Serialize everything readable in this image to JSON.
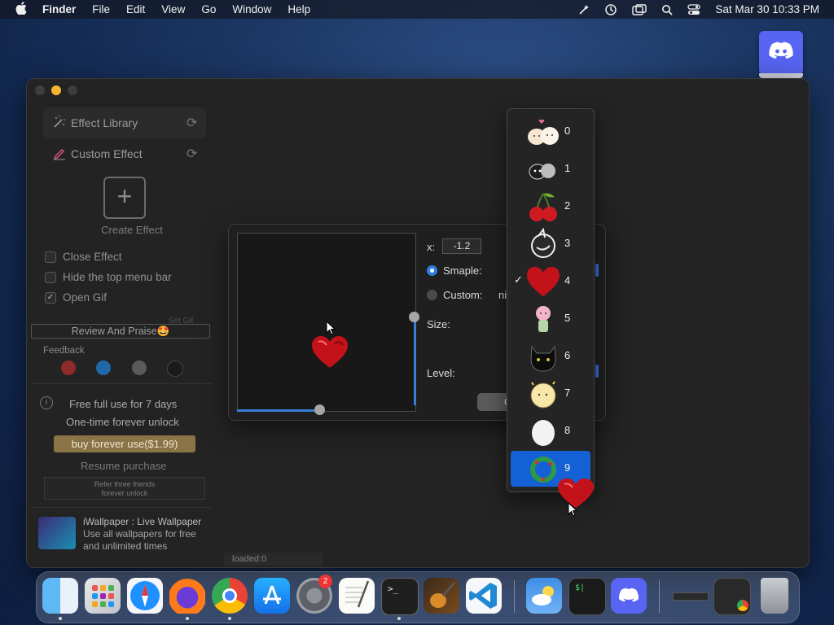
{
  "menubar": {
    "app_name": "Finder",
    "items": [
      "File",
      "Edit",
      "View",
      "Go",
      "Window",
      "Help"
    ],
    "clock": "Sat Mar 30  10:33 PM"
  },
  "sidebar": {
    "items": [
      {
        "label": "Effect Library",
        "icon": "sparkle-wand-icon"
      },
      {
        "label": "Custom Effect",
        "icon": "pen-icon"
      }
    ],
    "create_label": "Create Effect",
    "checkboxes": [
      {
        "label": "Close Effect",
        "checked": false
      },
      {
        "label": "Hide the top menu bar",
        "checked": false
      },
      {
        "label": "Open Gif",
        "checked": true
      }
    ],
    "set_gif_label": "Set Gif",
    "review_label": "Review And Praise🤩",
    "feedback_label": "Feedback",
    "trial_line1": "Free full use for 7 days",
    "trial_line2": "One-time forever unlock",
    "buy_label": "buy forever use($1.99)",
    "resume_label": "Resume purchase",
    "refer_line1": "Refer three friends",
    "refer_line2": "forever unlock",
    "ad_title": "iWallpaper : Live Wallpaper",
    "ad_line1": "Use all wallpapers for free",
    "ad_line2": "and unlimited times"
  },
  "status": {
    "loaded": "loaded:0"
  },
  "editor": {
    "x_label": "x:",
    "x_value": "-1.2",
    "sample_label": "Smaple:",
    "custom_label": "Custom:",
    "custom_value_partial": "ni",
    "size_label": "Size:",
    "level_label": "Level:",
    "button_partial": "C"
  },
  "dropdown": {
    "items": [
      "0",
      "1",
      "2",
      "3",
      "4",
      "5",
      "6",
      "7",
      "8",
      "9"
    ],
    "checked_index": 4,
    "highlighted_index": 9
  },
  "dock": {
    "apps": [
      "Finder",
      "Launchpad",
      "Safari",
      "Firefox",
      "Chrome",
      "App Store",
      "System Settings",
      "TextEdit",
      "Terminal",
      "GarageBand",
      "VS Code",
      "Weather",
      "Terminal 2",
      "Discord",
      "Recent Window",
      "Chrome Window",
      "Trash"
    ],
    "settings_badge": "2"
  },
  "colors": {
    "accent": "#1461d6",
    "buy_button": "#8a7347",
    "discord": "#5865f2"
  }
}
